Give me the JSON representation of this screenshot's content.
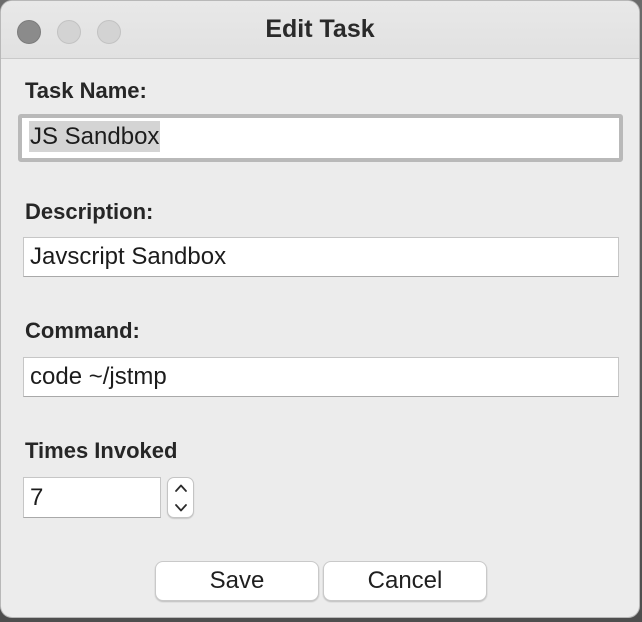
{
  "background_app": {
    "partial_text": "Edit Task"
  },
  "window": {
    "title": "Edit Task"
  },
  "form": {
    "task_name": {
      "label": "Task Name:",
      "value": "JS Sandbox"
    },
    "description": {
      "label": "Description:",
      "value": "Javscript Sandbox"
    },
    "command": {
      "label": "Command:",
      "value": "code ~/jstmp"
    },
    "times_invoked": {
      "label": "Times Invoked",
      "value": "7"
    }
  },
  "buttons": {
    "save": "Save",
    "cancel": "Cancel"
  },
  "icons": {
    "stepper_up": "chevron-up-icon",
    "stepper_down": "chevron-down-icon"
  }
}
